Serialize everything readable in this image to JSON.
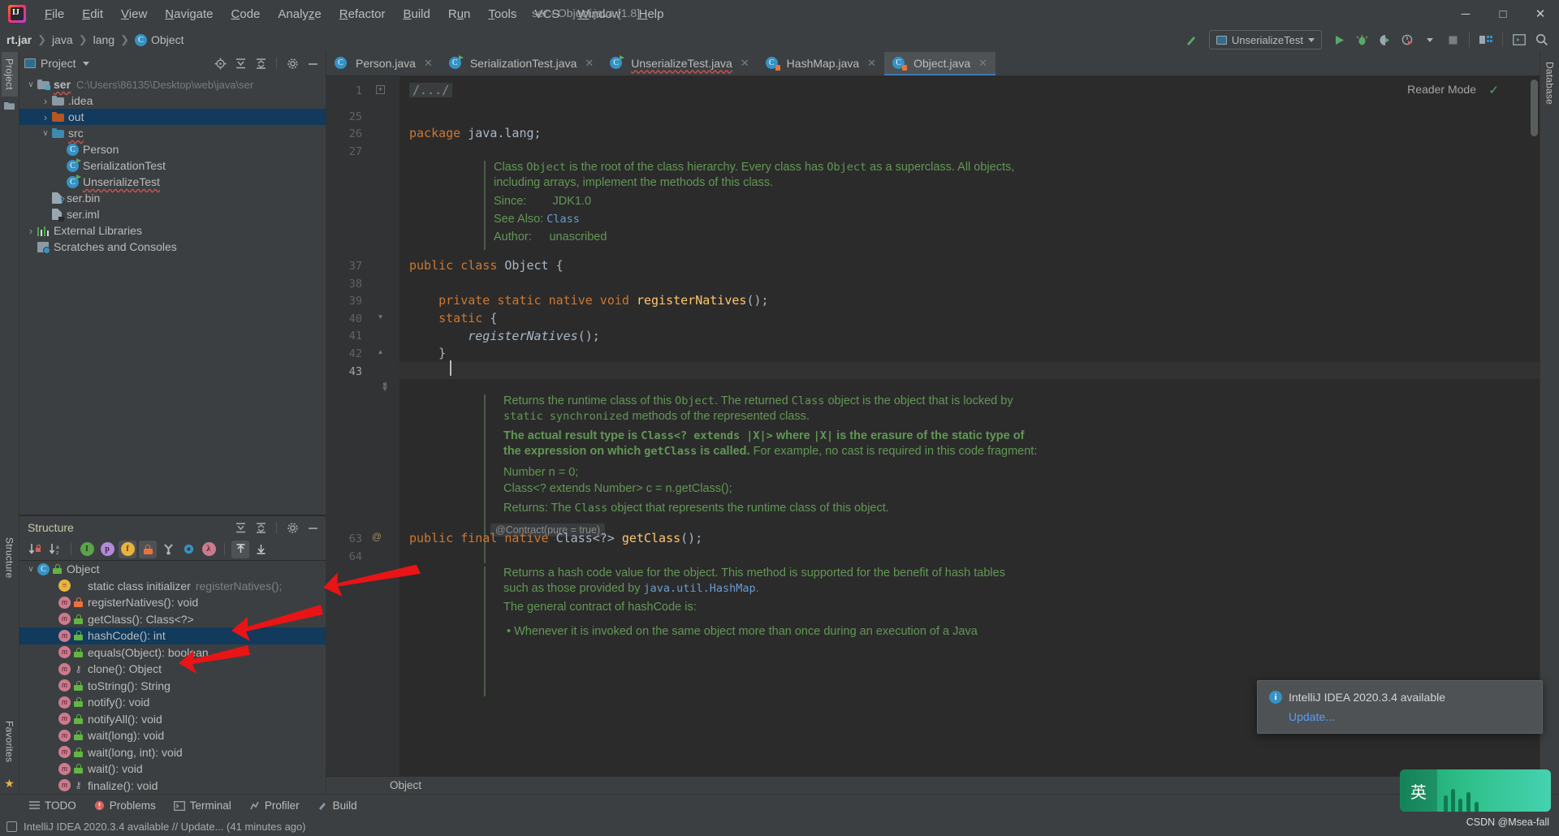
{
  "window": {
    "title": "ser - Object.java [1.8]",
    "minimize": "─",
    "maximize": "□",
    "close": "✕"
  },
  "menubar": [
    {
      "label": "File"
    },
    {
      "label": "Edit"
    },
    {
      "label": "View"
    },
    {
      "label": "Navigate"
    },
    {
      "label": "Code"
    },
    {
      "label": "Analyze"
    },
    {
      "label": "Refactor"
    },
    {
      "label": "Build"
    },
    {
      "label": "Run"
    },
    {
      "label": "Tools"
    },
    {
      "label": "VCS"
    },
    {
      "label": "Window"
    },
    {
      "label": "Help"
    }
  ],
  "breadcrumb": {
    "items": [
      "rt.jar",
      "java",
      "lang",
      "Object"
    ],
    "separator": "›"
  },
  "toolbar": {
    "run_config": "UnserializeTest",
    "icons": [
      "build-icon",
      "run-icon",
      "debug-icon",
      "coverage-icon",
      "profiler-icon",
      "stop-icon",
      "project-structure-icon",
      "terminal-icon",
      "search-everywhere-icon"
    ]
  },
  "left_rail": {
    "tabs": [
      "Project"
    ],
    "bottom_tabs": [
      "Structure",
      "Favorites"
    ]
  },
  "right_rail": {
    "tabs": [
      "Database"
    ]
  },
  "project_panel": {
    "title": "Project",
    "actions": [
      "locate-icon",
      "expand-all-icon",
      "collapse-all-icon",
      "gear-icon",
      "hide-icon"
    ],
    "tree": [
      {
        "label": "ser",
        "meta": "C:\\Users\\86135\\Desktop\\web\\java\\ser",
        "icon": "module-folder-icon",
        "arrow": "⌄",
        "depth": 0,
        "bold": true,
        "selected": false,
        "squiggle": true
      },
      {
        "label": ".idea",
        "meta": "",
        "icon": "folder-grey-icon",
        "arrow": "›",
        "depth": 1,
        "bold": false,
        "selected": false,
        "squiggle": false
      },
      {
        "label": "out",
        "meta": "",
        "icon": "folder-orange-icon",
        "arrow": "›",
        "depth": 1,
        "bold": false,
        "selected": true,
        "squiggle": false
      },
      {
        "label": "src",
        "meta": "",
        "icon": "folder-blue-icon",
        "arrow": "⌄",
        "depth": 1,
        "bold": false,
        "selected": false,
        "squiggle": true
      },
      {
        "label": "Person",
        "meta": "",
        "icon": "class-icon",
        "arrow": "",
        "depth": 2,
        "bold": false,
        "selected": false,
        "squiggle": false
      },
      {
        "label": "SerializationTest",
        "meta": "",
        "icon": "runnable-class-icon",
        "arrow": "",
        "depth": 2,
        "bold": false,
        "selected": false,
        "squiggle": false
      },
      {
        "label": "UnserializeTest",
        "meta": "",
        "icon": "runnable-class-icon",
        "arrow": "",
        "depth": 2,
        "bold": false,
        "selected": false,
        "squiggle": true
      },
      {
        "label": "ser.bin",
        "meta": "",
        "icon": "unknown-file-icon",
        "arrow": "",
        "depth": 1,
        "bold": false,
        "selected": false,
        "squiggle": false
      },
      {
        "label": "ser.iml",
        "meta": "",
        "icon": "iml-file-icon",
        "arrow": "",
        "depth": 1,
        "bold": false,
        "selected": false,
        "squiggle": false
      },
      {
        "label": "External Libraries",
        "meta": "",
        "icon": "libraries-icon",
        "arrow": "›",
        "depth": 0,
        "bold": false,
        "selected": false,
        "squiggle": false
      },
      {
        "label": "Scratches and Consoles",
        "meta": "",
        "icon": "scratches-icon",
        "arrow": "",
        "depth": 0,
        "bold": false,
        "selected": false,
        "squiggle": false
      }
    ]
  },
  "structure_panel": {
    "title": "Structure",
    "header_actions": [
      "expand-all-icon",
      "collapse-all-icon",
      "gear-icon",
      "hide-icon"
    ],
    "toolbar_icons": [
      {
        "name": "sort-by-visibility-icon",
        "glyph": "↓",
        "active": false
      },
      {
        "name": "sort-alphabetically-icon",
        "glyph": "↓",
        "active": false
      },
      {
        "name": "show-inherited-icon",
        "glyph": "I",
        "active": false,
        "color": "#5aa34a"
      },
      {
        "name": "show-properties-icon",
        "glyph": "p",
        "active": false,
        "color": "#b388d9"
      },
      {
        "name": "show-fields-icon",
        "glyph": "f",
        "active": true,
        "color": "#e8b33f"
      },
      {
        "name": "show-non-public-icon",
        "glyph": "ὑ2",
        "active": true,
        "color": "#e8733c"
      },
      {
        "name": "group-methods-icon",
        "glyph": "Y",
        "active": false,
        "color": "#b0b0b0"
      },
      {
        "name": "show-anonymous-icon",
        "glyph": "O",
        "active": false,
        "color": "#3592c4"
      },
      {
        "name": "show-lambdas-icon",
        "glyph": "λ",
        "active": false,
        "color": "#cb7b8d"
      },
      {
        "name": "autoscroll-to-source-icon",
        "glyph": "↑",
        "active": true
      },
      {
        "name": "autoscroll-from-source-icon",
        "glyph": "↓",
        "active": false
      }
    ],
    "items": [
      {
        "label": "Object",
        "meta": "",
        "icon": "class-icon",
        "access": "green-lock",
        "depth": 0,
        "arrow": "⌄",
        "selected": false
      },
      {
        "label": "static class initializer",
        "meta": "registerNatives();",
        "icon": "initializer-icon",
        "access": "none",
        "depth": 1,
        "arrow": "",
        "selected": false
      },
      {
        "label": "registerNatives(): void",
        "meta": "",
        "icon": "method-icon",
        "access": "orange-lock",
        "depth": 1,
        "arrow": "",
        "selected": false
      },
      {
        "label": "getClass(): Class<?>",
        "meta": "",
        "icon": "method-icon",
        "access": "green-lock",
        "depth": 1,
        "arrow": "",
        "selected": false
      },
      {
        "label": "hashCode(): int",
        "meta": "",
        "icon": "method-icon",
        "access": "green-lock",
        "depth": 1,
        "arrow": "",
        "selected": true
      },
      {
        "label": "equals(Object): boolean",
        "meta": "",
        "icon": "method-icon",
        "access": "green-lock",
        "depth": 1,
        "arrow": "",
        "selected": false
      },
      {
        "label": "clone(): Object",
        "meta": "",
        "icon": "method-icon",
        "access": "key",
        "depth": 1,
        "arrow": "",
        "selected": false
      },
      {
        "label": "toString(): String",
        "meta": "",
        "icon": "method-icon",
        "access": "green-lock",
        "depth": 1,
        "arrow": "",
        "selected": false
      },
      {
        "label": "notify(): void",
        "meta": "",
        "icon": "method-icon",
        "access": "green-lock",
        "depth": 1,
        "arrow": "",
        "selected": false
      },
      {
        "label": "notifyAll(): void",
        "meta": "",
        "icon": "method-icon",
        "access": "green-lock",
        "depth": 1,
        "arrow": "",
        "selected": false
      },
      {
        "label": "wait(long): void",
        "meta": "",
        "icon": "method-icon",
        "access": "green-lock",
        "depth": 1,
        "arrow": "",
        "selected": false
      },
      {
        "label": "wait(long, int): void",
        "meta": "",
        "icon": "method-icon",
        "access": "green-lock",
        "depth": 1,
        "arrow": "",
        "selected": false
      },
      {
        "label": "wait(): void",
        "meta": "",
        "icon": "method-icon",
        "access": "green-lock",
        "depth": 1,
        "arrow": "",
        "selected": false
      },
      {
        "label": "finalize(): void",
        "meta": "",
        "icon": "method-icon",
        "access": "key",
        "depth": 1,
        "arrow": "",
        "selected": false
      }
    ]
  },
  "editor": {
    "tabs": [
      {
        "label": "Person.java",
        "icon": "class-icon",
        "active": false,
        "error": false,
        "close": "✕"
      },
      {
        "label": "SerializationTest.java",
        "icon": "runnable-class-icon",
        "active": false,
        "error": false,
        "close": "✕"
      },
      {
        "label": "UnserializeTest.java",
        "icon": "runnable-class-icon",
        "active": false,
        "error": true,
        "close": "✕"
      },
      {
        "label": "HashMap.java",
        "icon": "library-class-icon",
        "active": false,
        "error": false,
        "close": "✕"
      },
      {
        "label": "Object.java",
        "icon": "library-class-icon",
        "active": true,
        "error": false,
        "close": "✕"
      }
    ],
    "reader_mode": "Reader Mode",
    "reader_check": "✓",
    "bottom_breadcrumb": "Object",
    "line_numbers": [
      "1",
      "25",
      "26",
      "27",
      "37",
      "38",
      "39",
      "40",
      "41",
      "42",
      "43",
      "63",
      "64"
    ],
    "folded_comment": "/.../",
    "lines": [
      {
        "n": "1",
        "kind": "fold",
        "text": "/.../"
      },
      {
        "n": "26",
        "kind": "code",
        "text": "package java.lang;"
      },
      {
        "n": "37",
        "kind": "code",
        "text": "public class Object {"
      },
      {
        "n": "39",
        "kind": "code",
        "text": "    private static native void registerNatives();"
      },
      {
        "n": "40",
        "kind": "code",
        "text": "    static {"
      },
      {
        "n": "41",
        "kind": "code",
        "text": "        registerNatives();"
      },
      {
        "n": "42",
        "kind": "code",
        "text": "    }"
      },
      {
        "n": "63",
        "kind": "code",
        "text": "public final native Class<?> getClass();"
      }
    ],
    "javadoc_class": {
      "p1_a": "Class ",
      "p1_code": "Object",
      "p1_b": " is the root of the class hierarchy. Every class has ",
      "p1_code2": "Object",
      "p1_c": " as a superclass. All objects,",
      "p2": "including arrays, implement the methods of this class.",
      "since_label": "Since:",
      "since_value": "JDK1.0",
      "seealso_label": "See Also:",
      "seealso_value": "Class",
      "author_label": "Author:",
      "author_value": "unascribed"
    },
    "javadoc_getclass": {
      "l1_a": "Returns the runtime class of this ",
      "l1_code": "Object",
      "l1_b": ". The returned ",
      "l1_code2": "Class",
      "l1_c": " object is the object that is locked by",
      "l2_code": "static synchronized",
      "l2_b": " methods of the represented class.",
      "l3_bold_a": "The actual result type is ",
      "l3_bold_code": "Class<? extends |X|>",
      "l3_bold_b": " where ",
      "l3_bold_code2": "|X|",
      "l3_bold_c": " is the erasure of the static type of",
      "l4_bold_a": "the expression on which ",
      "l4_bold_code": "getClass",
      "l4_bold_b": " is called.",
      "l4_rest": " For example, no cast is required in this code fragment:",
      "code1": "Number n = 0;",
      "code2": "Class<? extends Number> c = n.getClass();",
      "returns": "Returns: The Class object that represents the runtime class of this object.",
      "contract_chip": "@Contract(pure = true)"
    },
    "javadoc_hashcode": {
      "l1_a": "Returns a hash code value for the object. This method is supported for the benefit of hash tables",
      "l2_a": "such as those provided by ",
      "l2_code": "java.util.HashMap",
      "l2_b": ".",
      "l3": "The general contract of hashCode is:",
      "l4": "• Whenever it is invoked on the same object more than once during an execution of a Java"
    }
  },
  "tool_window_bar": {
    "buttons": [
      {
        "label": "TODO",
        "icon": "todo-icon"
      },
      {
        "label": "Problems",
        "icon": "problems-icon"
      },
      {
        "label": "Terminal",
        "icon": "terminal-icon"
      },
      {
        "label": "Profiler",
        "icon": "profiler-icon"
      },
      {
        "label": "Build",
        "icon": "build-icon"
      }
    ]
  },
  "status_bar": {
    "text": "IntelliJ IDEA 2020.3.4 available  //  Update...  (41 minutes ago)",
    "icon": "event-log-icon"
  },
  "notification": {
    "icon": "info-icon",
    "title": "IntelliJ IDEA 2020.3.4 available",
    "link": "Update..."
  },
  "ime_widget": {
    "mode": "英",
    "watermark": "CSDN @Msea-fall"
  },
  "colors": {
    "accent_blue": "#3592c4",
    "selection": "#113a5c",
    "javadoc_green": "#629755",
    "keyword_orange": "#cc7832",
    "method_yellow": "#ffc66d",
    "editor_bg": "#2b2b2b",
    "panel_bg": "#3c3f41",
    "arrow_red": "#e81416"
  }
}
